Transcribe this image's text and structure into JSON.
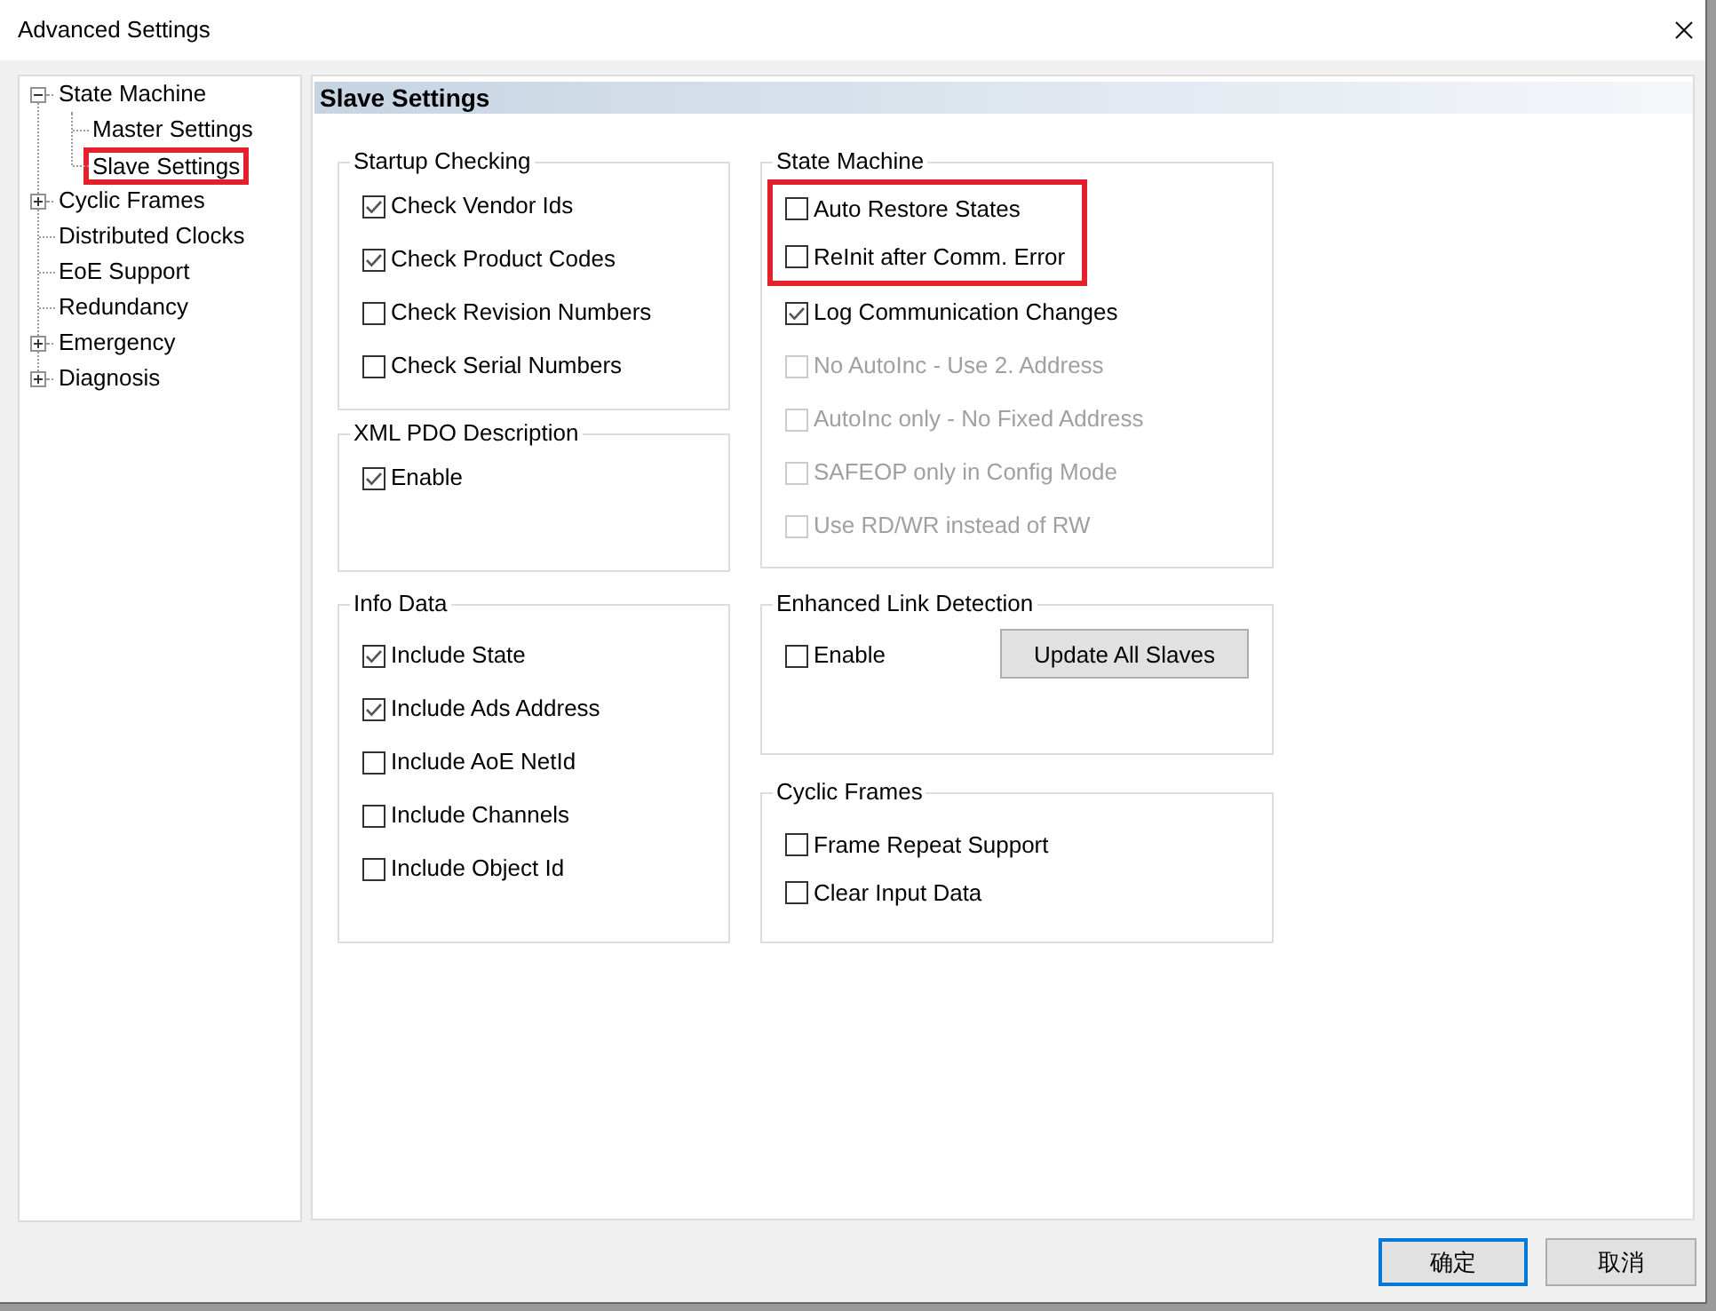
{
  "window": {
    "title": "Advanced Settings"
  },
  "tree": [
    {
      "label": "State Machine",
      "kind": "group",
      "expanded": true,
      "highlighted": false,
      "children": [
        {
          "label": "Master Settings",
          "kind": "item",
          "highlighted": false
        },
        {
          "label": "Slave Settings",
          "kind": "item",
          "highlighted": true
        }
      ]
    },
    {
      "label": "Cyclic Frames",
      "kind": "group",
      "expanded": false,
      "highlighted": false
    },
    {
      "label": "Distributed Clocks",
      "kind": "item",
      "highlighted": false
    },
    {
      "label": "EoE Support",
      "kind": "item",
      "highlighted": false
    },
    {
      "label": "Redundancy",
      "kind": "item",
      "highlighted": false
    },
    {
      "label": "Emergency",
      "kind": "group",
      "expanded": false,
      "highlighted": false
    },
    {
      "label": "Diagnosis",
      "kind": "group",
      "expanded": false,
      "highlighted": false
    }
  ],
  "panel": {
    "title": "Slave Settings",
    "columns": [
      {
        "groups": [
          {
            "title": "Startup Checking",
            "options": [
              {
                "label": "Check Vendor Ids",
                "checked": true
              },
              {
                "label": "Check Product Codes",
                "checked": true
              },
              {
                "label": "Check Revision Numbers",
                "checked": false
              },
              {
                "label": "Check Serial Numbers",
                "checked": false
              }
            ]
          },
          {
            "title": "XML PDO Description",
            "options": [
              {
                "label": "Enable",
                "checked": true
              }
            ]
          },
          {
            "title": "Info Data",
            "options": [
              {
                "label": "Include State",
                "checked": true
              },
              {
                "label": "Include Ads Address",
                "checked": true
              },
              {
                "label": "Include AoE NetId",
                "checked": false
              },
              {
                "label": "Include Channels",
                "checked": false
              },
              {
                "label": "Include Object Id",
                "checked": false
              }
            ]
          }
        ]
      },
      {
        "groups": [
          {
            "title": "State Machine",
            "options": [
              {
                "label": "Auto Restore States",
                "checked": false,
                "disabled": false,
                "highlighted": true
              },
              {
                "label": "ReInit after Comm. Error",
                "checked": false,
                "disabled": false,
                "highlighted": true
              },
              {
                "label": "Log Communication Changes",
                "checked": true,
                "disabled": false,
                "highlighted": false
              },
              {
                "label": "No AutoInc - Use 2. Address",
                "checked": false,
                "disabled": true,
                "highlighted": false
              },
              {
                "label": "AutoInc only - No Fixed Address",
                "checked": false,
                "disabled": true,
                "highlighted": false
              },
              {
                "label": "SAFEOP only in Config Mode",
                "checked": false,
                "disabled": true,
                "highlighted": false
              },
              {
                "label": "Use RD/WR instead of RW",
                "checked": false,
                "disabled": true,
                "highlighted": false
              }
            ]
          },
          {
            "title": "Enhanced Link Detection",
            "options": [
              {
                "label": "Enable",
                "checked": false
              }
            ],
            "button": "Update All Slaves"
          },
          {
            "title": "Cyclic Frames",
            "options": [
              {
                "label": "Frame Repeat Support",
                "checked": false
              },
              {
                "label": "Clear Input Data",
                "checked": false
              }
            ]
          }
        ]
      }
    ]
  },
  "buttons": [
    {
      "label": "确定",
      "default": true
    },
    {
      "label": "取消",
      "default": false
    }
  ]
}
